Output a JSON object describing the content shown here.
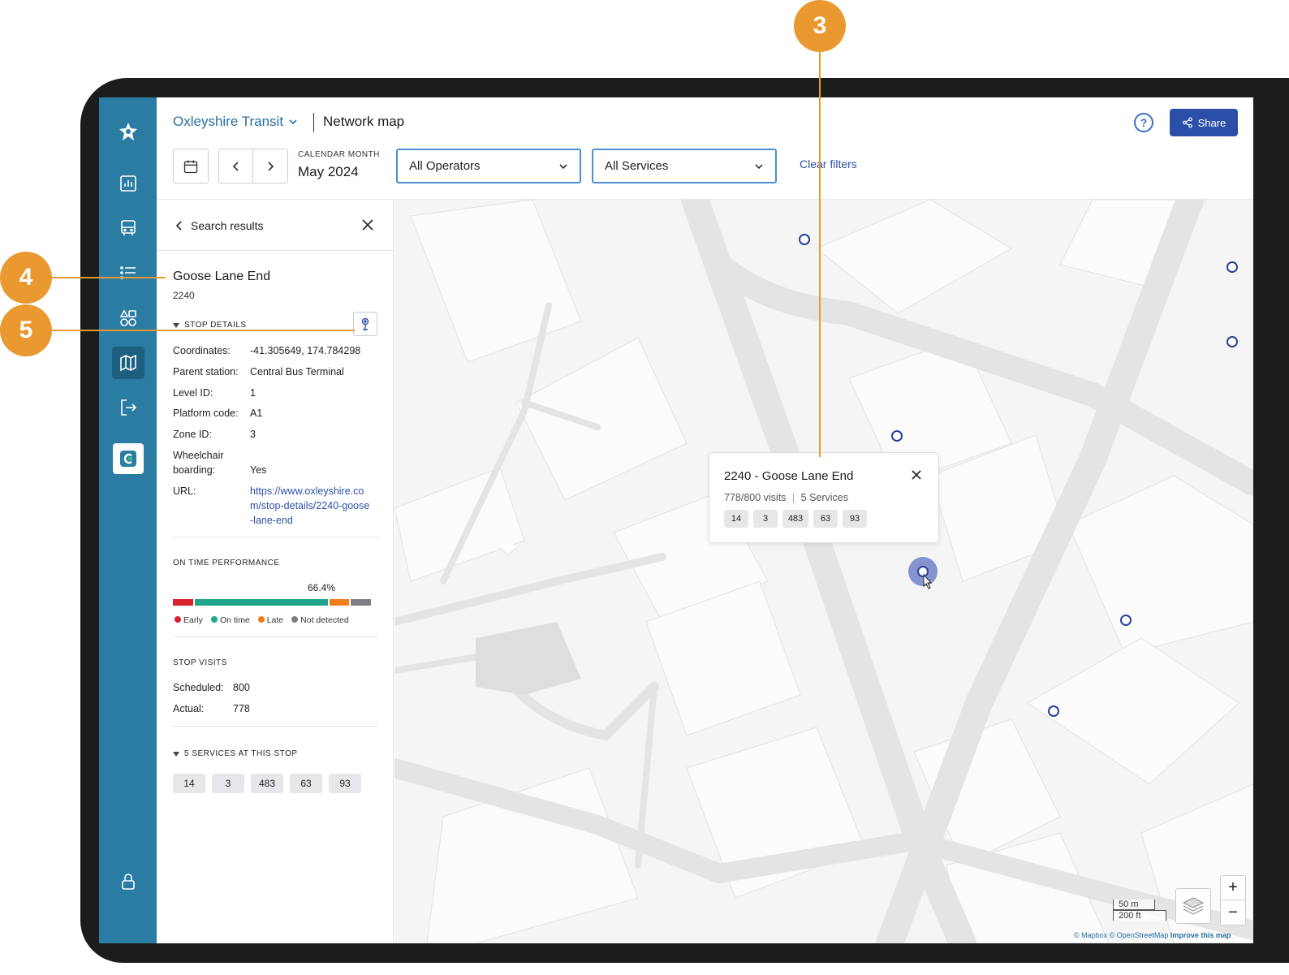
{
  "header": {
    "organization": "Oxleyshire Transit",
    "page_title": "Network map",
    "share_label": "Share",
    "help_symbol": "?"
  },
  "toolbar": {
    "calendar_label": "CALENDAR MONTH",
    "calendar_value": "May 2024",
    "operators_select": "All Operators",
    "services_select": "All Services",
    "clear_filters": "Clear filters"
  },
  "panel": {
    "back_label": "Search results",
    "stop_name": "Goose Lane End",
    "stop_code": "2240",
    "stop_details_heading": "STOP DETAILS",
    "details": [
      {
        "key": "Coordinates:",
        "value": "-41.305649, 174.784298"
      },
      {
        "key": "Parent station:",
        "value": "Central Bus Terminal"
      },
      {
        "key": "Level ID:",
        "value": "1"
      },
      {
        "key": "Platform code:",
        "value": "A1"
      },
      {
        "key": "Zone ID:",
        "value": "3"
      },
      {
        "key": "Wheelchair boarding:",
        "value": "Yes"
      },
      {
        "key": "URL:",
        "value": "https://www.oxleyshire.com/stop-details/2240-goose-lane-end"
      }
    ],
    "otp_heading": "ON TIME PERFORMANCE",
    "otp_value": "66.4%",
    "otp_split": {
      "early": 0.1,
      "on_time": 0.664,
      "late": 0.1,
      "not_detected": 0.1
    },
    "otp_legend": [
      "Early",
      "On time",
      "Late",
      "Not detected"
    ],
    "otp_colors": {
      "early": "#d9212f",
      "on_time": "#1fa68a",
      "late": "#ee7d1c",
      "not_detected": "#7d7f84"
    },
    "visits_heading": "STOP VISITS",
    "scheduled_label": "Scheduled:",
    "scheduled_value": "800",
    "actual_label": "Actual:",
    "actual_value": "778",
    "services_heading": "5 SERVICES AT THIS STOP",
    "services": [
      "14",
      "3",
      "483",
      "63",
      "93"
    ]
  },
  "popup": {
    "title": "2240 - Goose Lane End",
    "visits": "778/800 visits",
    "services_count": "5 Services",
    "services": [
      "14",
      "3",
      "483",
      "63",
      "93"
    ]
  },
  "map": {
    "scale_m": "50 m",
    "scale_ft": "200 ft",
    "attribution": [
      "© Mapbox",
      "© OpenStreetMap",
      "Improve this map"
    ],
    "zoom_in": "+",
    "zoom_out": "−"
  },
  "callouts": [
    "3",
    "4",
    "5"
  ],
  "colors": {
    "sidebar": "#2a7ca3",
    "accent": "#2b4fa8",
    "callout": "#e9992f",
    "stop_marker": "#2a3f9a"
  }
}
